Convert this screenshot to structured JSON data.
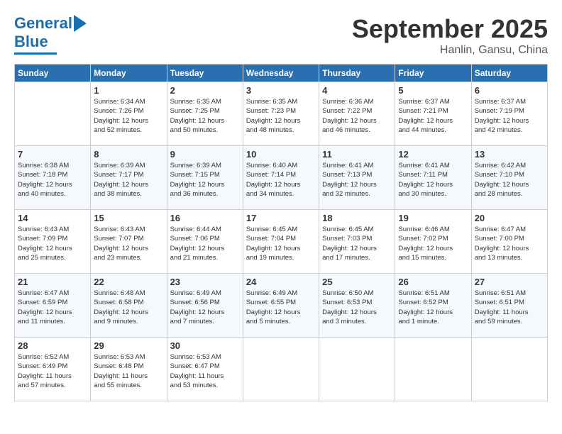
{
  "header": {
    "logo_line1": "General",
    "logo_line2": "Blue",
    "month": "September 2025",
    "location": "Hanlin, Gansu, China"
  },
  "weekdays": [
    "Sunday",
    "Monday",
    "Tuesday",
    "Wednesday",
    "Thursday",
    "Friday",
    "Saturday"
  ],
  "weeks": [
    [
      {
        "day": "",
        "info": ""
      },
      {
        "day": "1",
        "info": "Sunrise: 6:34 AM\nSunset: 7:26 PM\nDaylight: 12 hours\nand 52 minutes."
      },
      {
        "day": "2",
        "info": "Sunrise: 6:35 AM\nSunset: 7:25 PM\nDaylight: 12 hours\nand 50 minutes."
      },
      {
        "day": "3",
        "info": "Sunrise: 6:35 AM\nSunset: 7:23 PM\nDaylight: 12 hours\nand 48 minutes."
      },
      {
        "day": "4",
        "info": "Sunrise: 6:36 AM\nSunset: 7:22 PM\nDaylight: 12 hours\nand 46 minutes."
      },
      {
        "day": "5",
        "info": "Sunrise: 6:37 AM\nSunset: 7:21 PM\nDaylight: 12 hours\nand 44 minutes."
      },
      {
        "day": "6",
        "info": "Sunrise: 6:37 AM\nSunset: 7:19 PM\nDaylight: 12 hours\nand 42 minutes."
      }
    ],
    [
      {
        "day": "7",
        "info": "Sunrise: 6:38 AM\nSunset: 7:18 PM\nDaylight: 12 hours\nand 40 minutes."
      },
      {
        "day": "8",
        "info": "Sunrise: 6:39 AM\nSunset: 7:17 PM\nDaylight: 12 hours\nand 38 minutes."
      },
      {
        "day": "9",
        "info": "Sunrise: 6:39 AM\nSunset: 7:15 PM\nDaylight: 12 hours\nand 36 minutes."
      },
      {
        "day": "10",
        "info": "Sunrise: 6:40 AM\nSunset: 7:14 PM\nDaylight: 12 hours\nand 34 minutes."
      },
      {
        "day": "11",
        "info": "Sunrise: 6:41 AM\nSunset: 7:13 PM\nDaylight: 12 hours\nand 32 minutes."
      },
      {
        "day": "12",
        "info": "Sunrise: 6:41 AM\nSunset: 7:11 PM\nDaylight: 12 hours\nand 30 minutes."
      },
      {
        "day": "13",
        "info": "Sunrise: 6:42 AM\nSunset: 7:10 PM\nDaylight: 12 hours\nand 28 minutes."
      }
    ],
    [
      {
        "day": "14",
        "info": "Sunrise: 6:43 AM\nSunset: 7:09 PM\nDaylight: 12 hours\nand 25 minutes."
      },
      {
        "day": "15",
        "info": "Sunrise: 6:43 AM\nSunset: 7:07 PM\nDaylight: 12 hours\nand 23 minutes."
      },
      {
        "day": "16",
        "info": "Sunrise: 6:44 AM\nSunset: 7:06 PM\nDaylight: 12 hours\nand 21 minutes."
      },
      {
        "day": "17",
        "info": "Sunrise: 6:45 AM\nSunset: 7:04 PM\nDaylight: 12 hours\nand 19 minutes."
      },
      {
        "day": "18",
        "info": "Sunrise: 6:45 AM\nSunset: 7:03 PM\nDaylight: 12 hours\nand 17 minutes."
      },
      {
        "day": "19",
        "info": "Sunrise: 6:46 AM\nSunset: 7:02 PM\nDaylight: 12 hours\nand 15 minutes."
      },
      {
        "day": "20",
        "info": "Sunrise: 6:47 AM\nSunset: 7:00 PM\nDaylight: 12 hours\nand 13 minutes."
      }
    ],
    [
      {
        "day": "21",
        "info": "Sunrise: 6:47 AM\nSunset: 6:59 PM\nDaylight: 12 hours\nand 11 minutes."
      },
      {
        "day": "22",
        "info": "Sunrise: 6:48 AM\nSunset: 6:58 PM\nDaylight: 12 hours\nand 9 minutes."
      },
      {
        "day": "23",
        "info": "Sunrise: 6:49 AM\nSunset: 6:56 PM\nDaylight: 12 hours\nand 7 minutes."
      },
      {
        "day": "24",
        "info": "Sunrise: 6:49 AM\nSunset: 6:55 PM\nDaylight: 12 hours\nand 5 minutes."
      },
      {
        "day": "25",
        "info": "Sunrise: 6:50 AM\nSunset: 6:53 PM\nDaylight: 12 hours\nand 3 minutes."
      },
      {
        "day": "26",
        "info": "Sunrise: 6:51 AM\nSunset: 6:52 PM\nDaylight: 12 hours\nand 1 minute."
      },
      {
        "day": "27",
        "info": "Sunrise: 6:51 AM\nSunset: 6:51 PM\nDaylight: 11 hours\nand 59 minutes."
      }
    ],
    [
      {
        "day": "28",
        "info": "Sunrise: 6:52 AM\nSunset: 6:49 PM\nDaylight: 11 hours\nand 57 minutes."
      },
      {
        "day": "29",
        "info": "Sunrise: 6:53 AM\nSunset: 6:48 PM\nDaylight: 11 hours\nand 55 minutes."
      },
      {
        "day": "30",
        "info": "Sunrise: 6:53 AM\nSunset: 6:47 PM\nDaylight: 11 hours\nand 53 minutes."
      },
      {
        "day": "",
        "info": ""
      },
      {
        "day": "",
        "info": ""
      },
      {
        "day": "",
        "info": ""
      },
      {
        "day": "",
        "info": ""
      }
    ]
  ]
}
